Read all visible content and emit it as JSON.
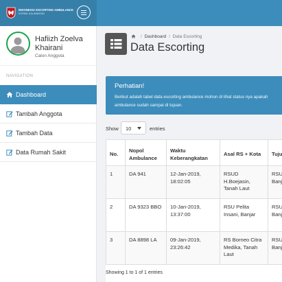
{
  "brand": {
    "title": "INDONESIA ESCORTING AMBULANCE",
    "subtitle": "KORWIL KALIMANTAN"
  },
  "user": {
    "name": "Hafiizh Zoelva Khairani",
    "role": "Calon Anggota"
  },
  "nav": {
    "header": "NAVIGATION",
    "items": [
      {
        "label": "Dashboard",
        "icon": "home-icon",
        "active": true
      },
      {
        "label": "Tambah Anggota",
        "icon": "edit-icon",
        "active": false
      },
      {
        "label": "Tambah Data",
        "icon": "edit-icon",
        "active": false
      },
      {
        "label": "Data Rumah Sakit",
        "icon": "edit-icon",
        "active": false
      }
    ]
  },
  "breadcrumb": {
    "home_icon": "home-icon",
    "items": [
      "Dashboard",
      "Data Escorting"
    ]
  },
  "page": {
    "title": "Data Escorting",
    "icon": "table-icon"
  },
  "alert": {
    "title": "Perhatian!",
    "body_line1": "Berikut adalah tabel data escorting ambulance mohon di lihat status nya apakah",
    "body_line2": "ambulance sudah sampai di tujuan."
  },
  "length_control": {
    "prefix": "Show",
    "selected": "10",
    "suffix": "entries"
  },
  "table": {
    "columns": [
      "No.",
      "Nopol Ambulance",
      "Waktu Keberangkatan",
      "Asal RS + Kota",
      "Tujuan"
    ],
    "rows": [
      [
        "1",
        "DA 941",
        "12-Jan-2019, 18:02:05",
        "RSUD H.Boejasin, Tanah Laut",
        "RSUD Banjar"
      ],
      [
        "2",
        "DA 9323 BBO",
        "10-Jan-2019, 13:37:00",
        "RSU Pelita Insani, Banjar",
        "RSUD Banjar"
      ],
      [
        "3",
        "DA 8898 LA",
        "09-Jan-2019, 23:26:42",
        "RS Borneo Citra Medika, Tanah Laut",
        "RSUD Banjar"
      ]
    ],
    "info": "Showing 1 to 1 of 1 entries"
  },
  "colors": {
    "topbar": "#3c8dbc",
    "brand_bg": "#367fa9",
    "active_nav": "#3c8dbc",
    "alert_bg": "#3c8dbc",
    "avatar_ring": "#17a34a"
  }
}
